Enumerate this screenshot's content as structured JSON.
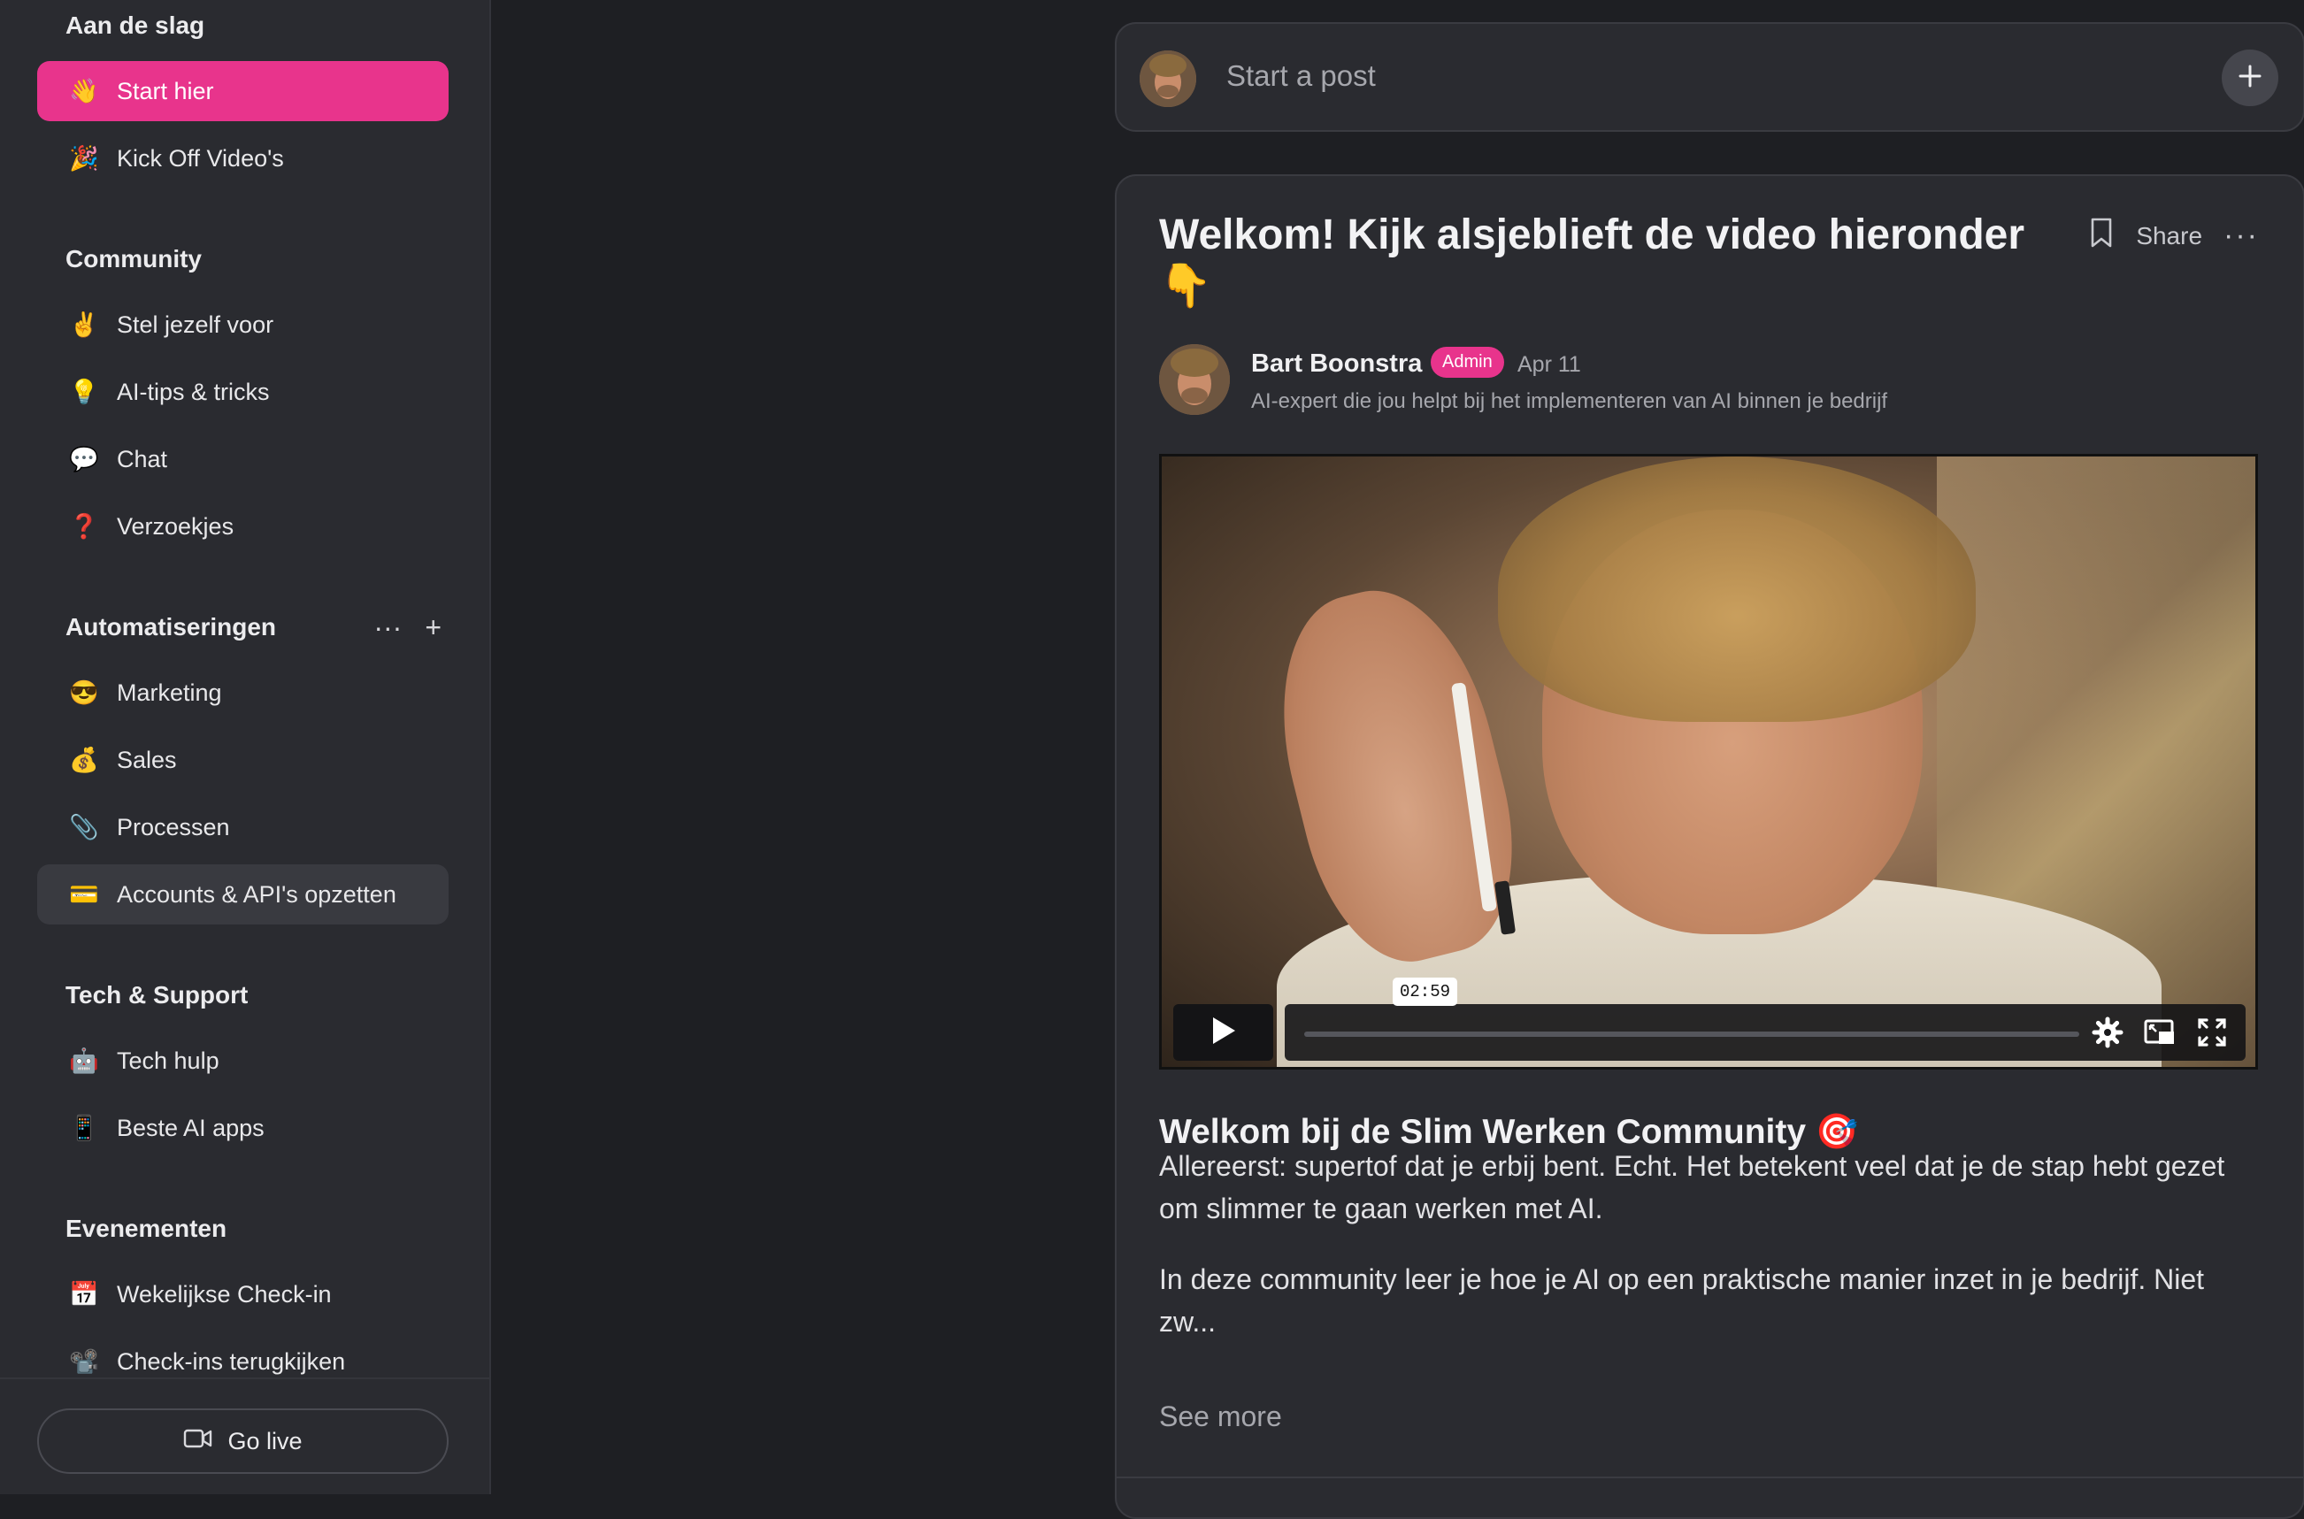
{
  "sidebar": {
    "sections": [
      {
        "title": "Aan de slag",
        "items": [
          {
            "label": "Start hier",
            "icon": "waving-hand-icon",
            "emoji": "👋"
          },
          {
            "label": "Kick Off Video's",
            "icon": "party-popper-icon",
            "emoji": "🎉"
          }
        ]
      },
      {
        "title": "Community",
        "items": [
          {
            "label": "Stel jezelf voor",
            "icon": "victory-hand-icon",
            "emoji": "✌️"
          },
          {
            "label": "AI-tips & tricks",
            "icon": "light-bulb-icon",
            "emoji": "💡"
          },
          {
            "label": "Chat",
            "icon": "speech-bubble-icon",
            "emoji": "💬"
          },
          {
            "label": "Verzoekjes",
            "icon": "question-mark-icon",
            "emoji": "❓"
          }
        ]
      },
      {
        "title": "Automatiseringen",
        "items": [
          {
            "label": "Marketing",
            "icon": "sunglasses-face-icon",
            "emoji": "😎"
          },
          {
            "label": "Sales",
            "icon": "money-bag-icon",
            "emoji": "💰"
          },
          {
            "label": "Processen",
            "icon": "paperclip-icon",
            "emoji": "📎"
          },
          {
            "label": "Accounts & API's opzetten",
            "icon": "credit-card-icon",
            "emoji": "💳"
          }
        ]
      },
      {
        "title": "Tech & Support",
        "items": [
          {
            "label": "Tech hulp",
            "icon": "robot-icon",
            "emoji": "🤖"
          },
          {
            "label": "Beste AI apps",
            "icon": "mobile-phone-icon",
            "emoji": "📱"
          }
        ]
      },
      {
        "title": "Evenementen",
        "items": [
          {
            "label": "Wekelijkse Check-in",
            "icon": "calendar-icon",
            "emoji": "📅"
          },
          {
            "label": "Check-ins terugkijken",
            "icon": "film-projector-icon",
            "emoji": "📽️"
          }
        ]
      }
    ],
    "active_item": "Start hier",
    "hovered_item": "Accounts & API's opzetten",
    "go_live_label": "Go live"
  },
  "composer": {
    "placeholder": "Start a post"
  },
  "post": {
    "title": "Welkom! Kijk alsjeblieft de video hieronder",
    "title_emoji": "👇",
    "share_label": "Share",
    "author": {
      "name": "Bart Boonstra",
      "badge": "Admin",
      "date": "Apr 11",
      "bio": "AI-expert die jou helpt bij het implementeren van AI binnen je bedrijf"
    },
    "video": {
      "time": "02:59"
    },
    "heading": "Welkom bij de Slim Werken Community",
    "heading_emoji": "🎯",
    "paragraph1": "Allereerst: supertof dat je erbij bent. Echt. Het betekent veel dat je de stap hebt gezet om slimmer te gaan werken met AI.",
    "paragraph2": "In deze community leer je hoe je AI op een praktische manier inzet in je bedrijf. Niet zw...",
    "see_more_label": "See more"
  },
  "colors": {
    "accent": "#e8348c",
    "background": "#1e1f23",
    "panel": "#2a2b30"
  }
}
